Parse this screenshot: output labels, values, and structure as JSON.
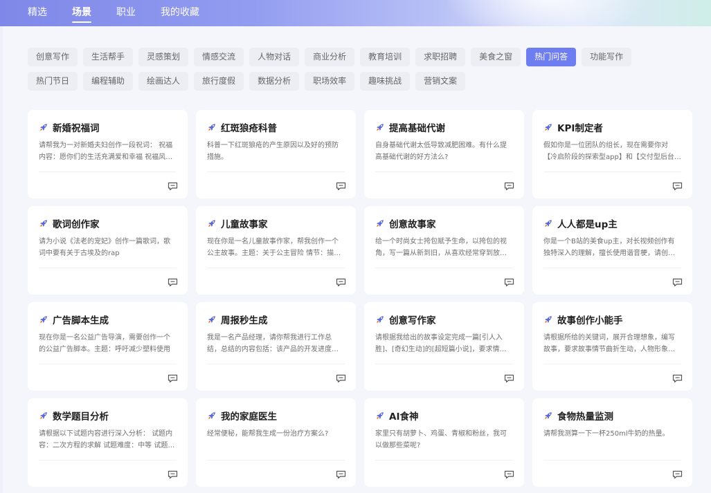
{
  "nav": {
    "items": [
      {
        "label": "精选",
        "active": false
      },
      {
        "label": "场景",
        "active": true
      },
      {
        "label": "职业",
        "active": false
      },
      {
        "label": "我的收藏",
        "active": false
      }
    ]
  },
  "tags": [
    {
      "label": "创意写作",
      "active": false
    },
    {
      "label": "生活帮手",
      "active": false
    },
    {
      "label": "灵感策划",
      "active": false
    },
    {
      "label": "情感交流",
      "active": false
    },
    {
      "label": "人物对话",
      "active": false
    },
    {
      "label": "商业分析",
      "active": false
    },
    {
      "label": "教育培训",
      "active": false
    },
    {
      "label": "求职招聘",
      "active": false
    },
    {
      "label": "美食之窗",
      "active": false
    },
    {
      "label": "热门问答",
      "active": true
    },
    {
      "label": "功能写作",
      "active": false
    },
    {
      "label": "热门节日",
      "active": false
    },
    {
      "label": "编程辅助",
      "active": false
    },
    {
      "label": "绘画达人",
      "active": false
    },
    {
      "label": "旅行度假",
      "active": false
    },
    {
      "label": "数据分析",
      "active": false
    },
    {
      "label": "职场效率",
      "active": false
    },
    {
      "label": "趣味挑战",
      "active": false
    },
    {
      "label": "营销文案",
      "active": false
    }
  ],
  "cards": [
    {
      "title": "新婚祝福词",
      "desc": "请帮我为一对新婚夫妇创作一段祝词： 祝福内容：愿你们的生活充满爱和幸福 祝福风格：..."
    },
    {
      "title": "红斑狼疮科普",
      "desc": "科普一下红斑狼疮的产生原因以及好的预防措施。"
    },
    {
      "title": "提高基础代谢",
      "desc": "自身基础代谢太低导致减肥困难。有什么提高基础代谢的好方法么?"
    },
    {
      "title": "KPI制定者",
      "desc": "假如你是一位团队的组长，现在需要你对【冷启阶段的探索型app】和【交付型后台】制..."
    },
    {
      "title": "歌词创作家",
      "desc": "请为小说《法老的宠妃》创作一篇歌词，歌词中要有关于古埃及的rap"
    },
    {
      "title": "儿童故事家",
      "desc": "现在你是一名儿童故事作家，帮我创作一个公主故事。主题：关于公主冒险 情节：描述一..."
    },
    {
      "title": "创意故事家",
      "desc": "给一个时尚女士挎包赋予生命，以挎包的视角，写一篇从新到旧，从喜欢经常穿到放在..."
    },
    {
      "title": "人人都是up主",
      "desc": "你是一个B站的美食up主，对长视频创作有独特深入的理解，擅长使用谐音梗，请创作一..."
    },
    {
      "title": "广告脚本生成",
      "desc": "现在你是一名公益广告导演，需要创作一个的公益广告脚本。主题：呼吁减少塑料使用"
    },
    {
      "title": "周报秒生成",
      "desc": "我是一名产品经理，请你帮我进行工作总结，总结的内容包括：该产品的开发进度、遇到..."
    },
    {
      "title": "创意写作家",
      "desc": "请根据我给出的故事设定完成一篇[引人入胜]、[奇幻生动]的[超短篇小说]，要求情节[..."
    },
    {
      "title": "故事创作小能手",
      "desc": "请根据所给的关键词，展开合理想象，编写故事，要求故事情节曲折生动，人物形象鲜明..."
    },
    {
      "title": "数学题目分析",
      "desc": "请根据以下试题内容进行深入分析： 试题内容：二次方程的求解 试题难度：中等 试题考..."
    },
    {
      "title": "我的家庭医生",
      "desc": "经常便秘，能帮我生成一份治疗方案么?"
    },
    {
      "title": "AI食神",
      "desc": "家里只有胡萝卜、鸡蛋、青椒和粉丝，我可以做那些菜呢?"
    },
    {
      "title": "食物热量监测",
      "desc": "请帮我测算一下一杯250ml牛奶的热量。"
    }
  ],
  "icons": {
    "card_title": "rocket-icon",
    "card_action": "chat-icon"
  },
  "colors": {
    "accent": "#6e7ef0",
    "tag_bg": "#eceef4"
  }
}
